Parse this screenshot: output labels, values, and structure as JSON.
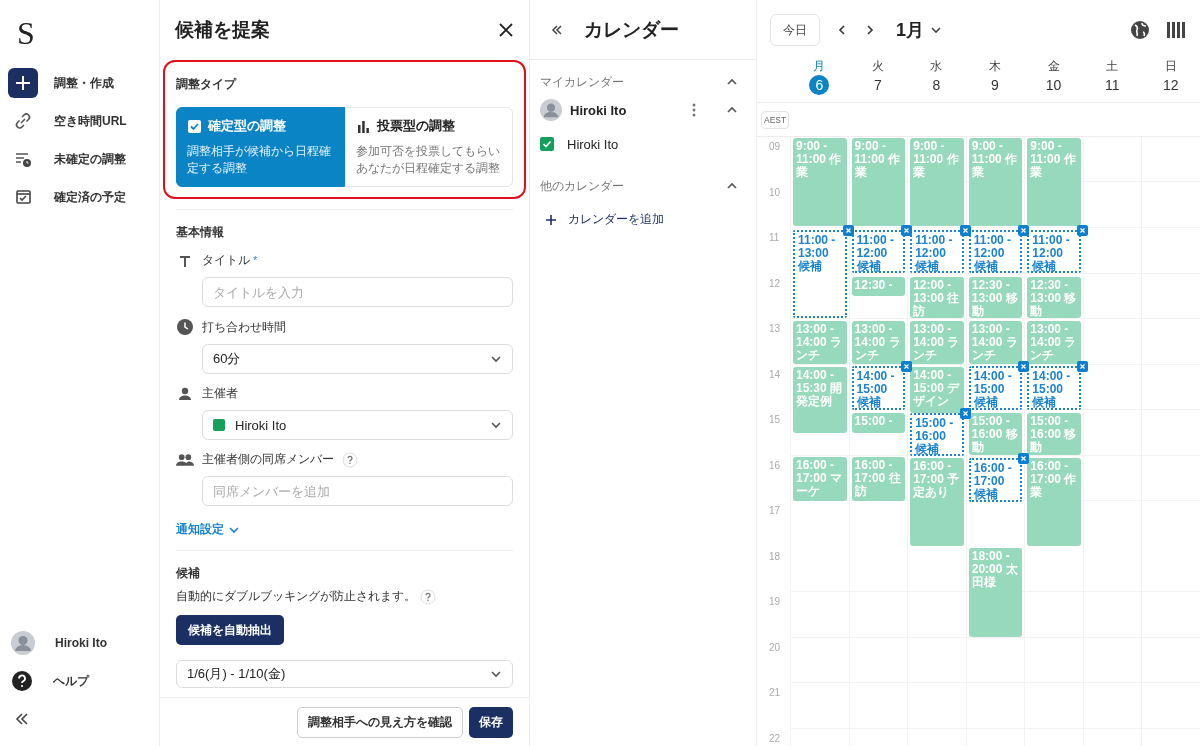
{
  "nav": {
    "logo": "S",
    "items": [
      {
        "kind": "create",
        "label": "調整・作成",
        "selected": true
      },
      {
        "kind": "link",
        "label": "空き時間URL",
        "selected": false
      },
      {
        "kind": "pending",
        "label": "未確定の調整",
        "selected": false
      },
      {
        "kind": "confirmed",
        "label": "確定済の予定",
        "selected": false
      }
    ],
    "user": "Hiroki Ito",
    "help": "ヘルプ"
  },
  "panel": {
    "title": "候補を提案",
    "type_section": {
      "label": "調整タイプ",
      "options": [
        {
          "kind": "fixed",
          "title": "確定型の調整",
          "description": "調整相手が候補から日程確定する調整",
          "selected": true
        },
        {
          "kind": "poll",
          "title": "投票型の調整",
          "description": "参加可否を投票してもらいあなたが日程確定する調整",
          "selected": false
        }
      ]
    },
    "basic_section": {
      "label": "基本情報",
      "title_field": {
        "label": "タイトル",
        "required_mark": "*",
        "placeholder": "タイトルを入力"
      },
      "duration": {
        "label": "打ち合わせ時間",
        "value": "60分"
      },
      "organizer": {
        "label": "主催者",
        "value": "Hiroki Ito"
      },
      "members": {
        "label": "主催者側の同席メンバー",
        "placeholder": "同席メンバーを追加"
      },
      "notification_link": "通知設定"
    },
    "candidates_section": {
      "label": "候補",
      "description": "自動的にダブルブッキングが防止されます。",
      "button": "候補を自動抽出",
      "range": "1/6(月) - 1/10(金)"
    },
    "footer": {
      "preview_button": "調整相手への見え方を確認",
      "save_button": "保存"
    }
  },
  "calendars": {
    "title": "カレンダー",
    "my_section": {
      "label": "マイカレンダー",
      "expanded": true,
      "account": {
        "name": "Hiroki Ito",
        "expanded": true
      },
      "items": [
        {
          "name": "Hiroki Ito",
          "checked": true
        }
      ]
    },
    "other_section": {
      "label": "他のカレンダー",
      "expanded": true,
      "add": "カレンダーを追加"
    }
  },
  "week": {
    "today_button": "今日",
    "month": "1月",
    "timezone": "AEST",
    "days": [
      {
        "weekday": "月",
        "date": "6",
        "today": true,
        "events": [
          {
            "kind": "busy",
            "text": "9:00 - 11:00 作業"
          },
          {
            "kind": "candidate",
            "text": "11:00 - 13:00 候補"
          },
          {
            "kind": "busy",
            "text": "13:00 - 14:00 ランチ"
          },
          {
            "kind": "busy",
            "text": "14:00 - 15:30 開発定例"
          },
          {
            "kind": "busy",
            "text": "16:00 - 17:00 マーケ"
          }
        ]
      },
      {
        "weekday": "火",
        "date": "7",
        "today": false,
        "events": [
          {
            "kind": "busy",
            "text": "9:00 - 11:00 作業"
          },
          {
            "kind": "candidate",
            "text": "11:00 - 12:00 候補"
          },
          {
            "kind": "busy",
            "text": "12:30 -"
          },
          {
            "kind": "busy",
            "text": "13:00 - 14:00 ランチ"
          },
          {
            "kind": "candidate",
            "text": "14:00 - 15:00 候補"
          },
          {
            "kind": "busy",
            "text": "15:00 -"
          },
          {
            "kind": "busy",
            "text": "16:00 - 17:00 往訪"
          }
        ]
      },
      {
        "weekday": "水",
        "date": "8",
        "today": false,
        "events": [
          {
            "kind": "busy",
            "text": "9:00 - 11:00 作業"
          },
          {
            "kind": "candidate",
            "text": "11:00 - 12:00 候補"
          },
          {
            "kind": "busy",
            "text": "12:00 - 13:00 往訪"
          },
          {
            "kind": "busy",
            "text": "13:00 - 14:00 ランチ"
          },
          {
            "kind": "busy",
            "text": "14:00 - 15:00 デザイン"
          },
          {
            "kind": "candidate",
            "text": "15:00 - 16:00 候補"
          },
          {
            "kind": "busy",
            "text": "16:00 - 17:00 予定あり"
          }
        ]
      },
      {
        "weekday": "木",
        "date": "9",
        "today": false,
        "events": [
          {
            "kind": "busy",
            "text": "9:00 - 11:00 作業"
          },
          {
            "kind": "candidate",
            "text": "11:00 - 12:00 候補"
          },
          {
            "kind": "busy",
            "text": "12:30 - 13:00 移動"
          },
          {
            "kind": "busy",
            "text": "13:00 - 14:00 ランチ"
          },
          {
            "kind": "candidate",
            "text": "14:00 - 15:00 候補"
          },
          {
            "kind": "busy",
            "text": "15:00 - 16:00 移動"
          },
          {
            "kind": "candidate",
            "text": "16:00 - 17:00 候補"
          },
          {
            "kind": "busy",
            "text": "18:00 - 20:00 太田様"
          }
        ]
      },
      {
        "weekday": "金",
        "date": "10",
        "today": false,
        "events": [
          {
            "kind": "busy",
            "text": "9:00 - 11:00 作業"
          },
          {
            "kind": "candidate",
            "text": "11:00 - 12:00 候補"
          },
          {
            "kind": "busy",
            "text": "12:30 - 13:00 移動"
          },
          {
            "kind": "busy",
            "text": "13:00 - 14:00 ランチ"
          },
          {
            "kind": "candidate",
            "text": "14:00 - 15:00 候補"
          },
          {
            "kind": "busy",
            "text": "15:00 - 16:00 移動"
          },
          {
            "kind": "busy",
            "text": "16:00 - 17:00 作業"
          }
        ]
      },
      {
        "weekday": "土",
        "date": "11",
        "today": false
      },
      {
        "weekday": "日",
        "date": "12",
        "today": false
      }
    ],
    "hours": [
      "09",
      "10",
      "11",
      "12",
      "13",
      "14",
      "15",
      "16",
      "17",
      "18",
      "19",
      "20",
      "21",
      "22"
    ]
  }
}
